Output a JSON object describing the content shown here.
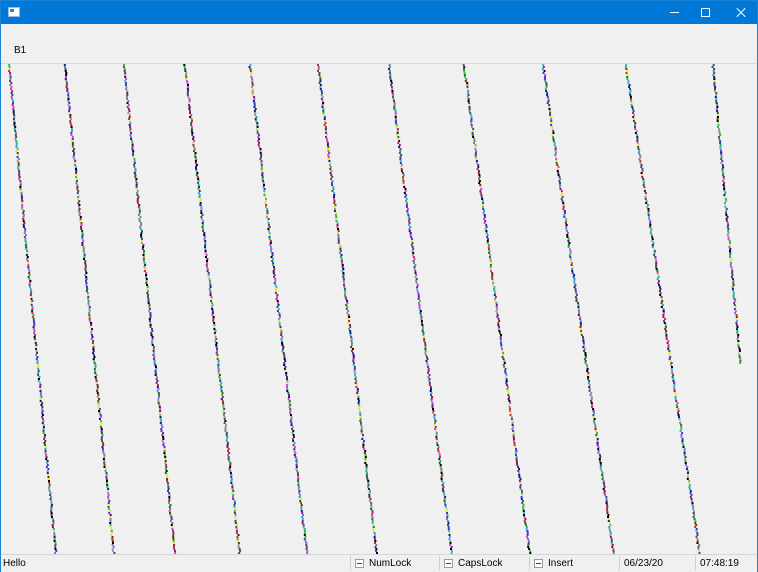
{
  "window": {
    "title": ""
  },
  "toolbar": {
    "b1_label": "B1"
  },
  "statusbar": {
    "message": "Hello",
    "numlock": "NumLock",
    "capslock": "CapsLock",
    "insert": "Insert",
    "date": "06/23/20",
    "time": "07:48:19"
  },
  "icons": [
    "app-icon",
    "minimize-icon",
    "maximize-icon",
    "close-icon",
    "indicator-led-icon"
  ],
  "colors": {
    "titlebar": "#0078d7",
    "background": "#f0f0f0",
    "dot_palette": [
      "#000000",
      "#1b1b8f",
      "#3d3dd6",
      "#31c231",
      "#e23ae2",
      "#7a2a2a",
      "#2fa5a5",
      "#9a9a9a",
      "#e4e440",
      "#2a6f2a",
      "#6a2ba8",
      "#c03030",
      "#3ab0e0"
    ]
  }
}
